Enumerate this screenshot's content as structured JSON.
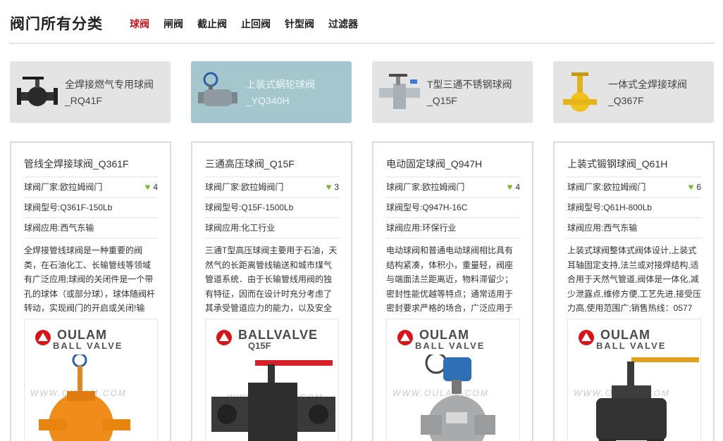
{
  "header": {
    "title": "阀门所有分类",
    "tabs": [
      "球阀",
      "闸阀",
      "截止阀",
      "止回阀",
      "针型阀",
      "过滤器"
    ]
  },
  "featured": [
    {
      "label": "全焊接燃气专用球阀_RQ41F",
      "icon": "ball-valve-lever-image"
    },
    {
      "label": "上装式蜗轮球阀_YQ340H",
      "icon": "worm-gear-ball-valve-image"
    },
    {
      "label": "T型三通不锈钢球阀_Q15F",
      "icon": "three-way-valve-image"
    },
    {
      "label": "一体式全焊接球阀_Q367F",
      "icon": "welded-ball-valve-image"
    }
  ],
  "cards": [
    {
      "name": "管线全焊接球阀_Q361F",
      "maker": "球阀厂家:欧拉姆阀门",
      "likes": "4",
      "model": "球阀型号:Q361F-150Lb",
      "app": "球阀应用:西气东输",
      "desc": "全焊接管线球阀是一种重要的阀类，在石油化工、长输管线等领域有广泛应用;球阀的关闭件是一个带孔的球体（或部分球），球体随阀杆转动，实现阀门的开启或关闭!输",
      "brand": "OULAM",
      "brand_sub": "BALL VALVE",
      "watermark": "WWW.OULAM.COM"
    },
    {
      "name": "三通高压球阀_Q15F",
      "maker": "球阀厂家:欧拉姆阀门",
      "likes": "3",
      "model": "球阀型号:Q15F-1500Lb",
      "app": "球阀应用:化工行业",
      "desc": "三通T型高压球阀主要用于石油，天然气的长距离管线输送和城市煤气管道系统．由于长输管线用阀的独有特征，因而在设计时充分考虑了其承受管道应力的能力，以及安全",
      "brand": "BALLVALVE",
      "brand_sub": "Q15F",
      "watermark": "WWW.OULAM.COM"
    },
    {
      "name": "电动固定球阀_Q947H",
      "maker": "球阀厂家:欧拉姆阀门",
      "likes": "4",
      "model": "球阀型号:Q947H-16C",
      "app": "球阀应用:环保行业",
      "desc": "电动球阀和普通电动球阀相比具有结构紧凑，体积小，重量轻，阀座与端面法兰距离近，物料滞留少；密封性能优越等特点；通常适用于密封要求严格的场合，广泛应用于",
      "brand": "OULAM",
      "brand_sub": "BALL VALVE",
      "watermark": "WWW.OULAM.COM"
    },
    {
      "name": "上装式锻钢球阀_Q61H",
      "maker": "球阀厂家:欧拉姆阀门",
      "likes": "6",
      "model": "球阀型号:Q61H-800Lb",
      "app": "球阀应用:西气东输",
      "desc": "上装式球阀整体式阀体设计,上装式耳轴固定支持,法兰或对接焊结构,适合用于天然气管道,阀体是一体化,减少泄露点,维修方便,工艺先进,接受压力高,使用范围广;销售热线：0577",
      "brand": "OULAM",
      "brand_sub": "BALL VALVE",
      "watermark": "WWW.OULAM.COM"
    }
  ],
  "colors": {
    "accent": "#c8161d",
    "heart": "#7cb82f",
    "featured_active": "#a3c7cc"
  }
}
